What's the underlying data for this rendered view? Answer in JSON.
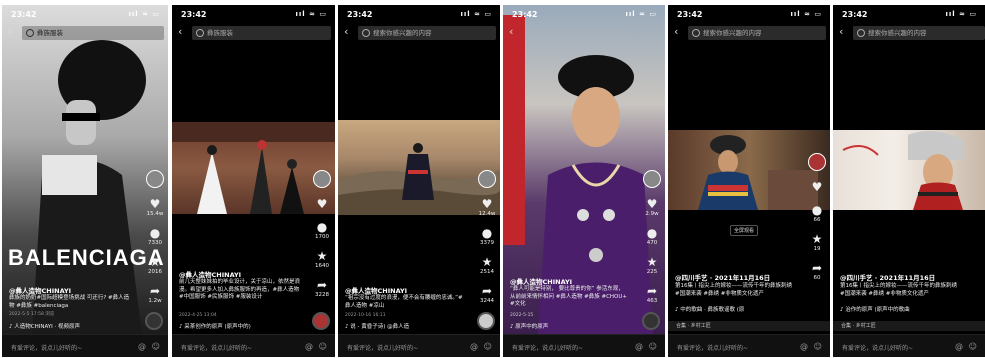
{
  "common": {
    "time": "23:42",
    "signal": "ııl ≈ ▭",
    "comment_placeholder": "有爱评论，说点儿好听的~",
    "at": "@",
    "emoji": "☺"
  },
  "p1": {
    "search_text": "彝族服装",
    "logo": "BALENCIAGA",
    "likes": "15.4w",
    "comments": "7330",
    "stars": "2016",
    "shares": "1.2w",
    "handle": "@彝人造物CHINAYI",
    "desc": "彝族的奶奶#国际超模登场挑战 可还行? #彝人造物 #彝族 #balenciaga",
    "date": "2022-5-5 17:58",
    "views": "浏览",
    "music": "♪ 人造物CHINAYI  · 视频原声"
  },
  "p2": {
    "search_text": "彝族服装",
    "likes": "",
    "comments": "1700",
    "stars": "1640",
    "shares": "3228",
    "handle": "@彝人造物CHINAYI",
    "desc": "前几天整妹妹拍的毕业设计，关于凉山，依然是浪漫。希望更多人加入彝族服饰的再造，#彝人造物 #中国服饰 #民族服饰 #服装设计",
    "date": "2022-4-25 13:04",
    "music": "♪ 采茶创作的原声 (原声中的)"
  },
  "p3": {
    "search_text": "搜索你感兴趣的内容",
    "likes": "12.4w",
    "comments": "3379",
    "stars": "2514",
    "shares": "3244",
    "handle": "@彝人造物CHINAYI",
    "desc": "“祖宗没有过度的浪漫，便不会有腰缠的忠诚。”#彝人造物 #凉山",
    "date": "2022-10-16 16:11",
    "music": "♪ 说 - 黄昏子诗)  @彝人造"
  },
  "p4": {
    "search_text": "",
    "likes": "2.9w",
    "comments": "470",
    "stars": "225",
    "shares": "463",
    "handle": "@彝人造物CHINAYI",
    "desc": "“彝人可能是特别， 要比尊贵的你” 参活东观，从前前来情怀相问 #彝人造物 #彝族 #CHOU+ #文化",
    "date": "2022-5-15",
    "music": "♪ 原声中的原声"
  },
  "p5": {
    "search_text": "搜索你感兴趣的内容",
    "likes": "",
    "comments": "66",
    "stars": "19",
    "shares": "60",
    "fullscreen": "全屏观看",
    "handle": "@四川手艺 · 2021年11月16日",
    "desc": "第16集丨指尖上的嫁妆——流传千年的彝族刺绣#国潮来袭 #彝绣 #非物质文化遗产",
    "music": "♪ 中的歌曲 · 彝族歌谣歌 (原",
    "collection": "合集 · 乡村工匠"
  },
  "p6": {
    "search_text": "搜索你感兴趣的内容",
    "handle": "@四川手艺 · 2021年11月16日",
    "desc": "第16集丨指尖上的嫁妆——流传千年的彝族刺绣#国潮来袭 #彝绣 #非物质文化遗产",
    "music": "♪ 治作的原声 (原声中的歌曲",
    "collection": "合集 · 乡村工匠"
  }
}
